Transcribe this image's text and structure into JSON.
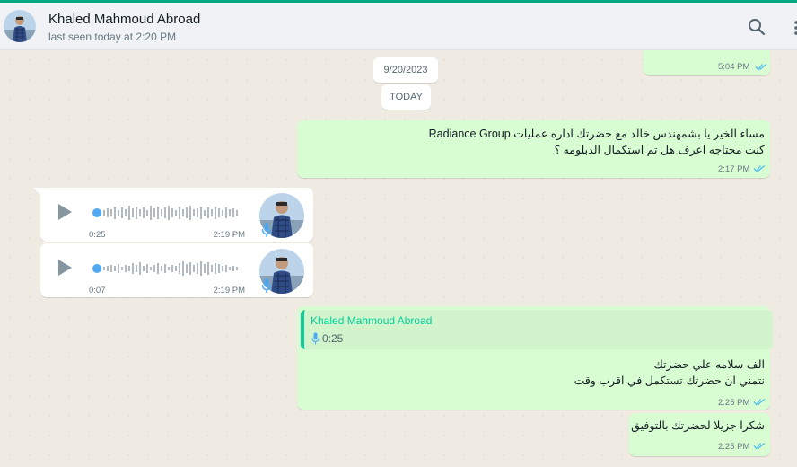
{
  "header": {
    "contact_name": "Khaled Mahmoud Abroad",
    "status": "last seen today at 2:20 PM"
  },
  "chat": {
    "top_partial_message": {
      "time": "5:04 PM"
    },
    "date_chips": [
      "9/20/2023",
      "TODAY"
    ],
    "message_1": {
      "line1": "مساء الخير يا بشمهندس خالد مع حضرتك اداره عمليات Radiance Group",
      "line2": "كنت محتاجه اعرف هل تم استكمال الدبلومه ؟",
      "time": "2:17 PM"
    },
    "voice_1": {
      "duration": "0:25",
      "time": "2:19 PM"
    },
    "voice_2": {
      "duration": "0:07",
      "time": "2:19 PM"
    },
    "reply_message": {
      "quoted_name": "Khaled Mahmoud Abroad",
      "quoted_duration": "0:25",
      "line1": "الف سلامه علي حضرتك",
      "line2": "نتمني ان حضرتك تستكمل في اقرب وقت",
      "time": "2:25 PM"
    },
    "message_last": {
      "text": "شكرا جزيلا لحضرتك بالتوفيق",
      "time": "2:25 PM"
    }
  },
  "icons": {
    "search": "search-icon",
    "menu": "menu-dots-icon",
    "play": "play-icon",
    "mic": "microphone-icon",
    "ticks": "double-check-icon"
  },
  "colors": {
    "accent": "#00a884",
    "outgoing_bubble": "#d9fdd3",
    "incoming_bubble": "#ffffff",
    "read_ticks": "#53bdeb",
    "voice_dot": "#4fa8f1",
    "quote_name": "#06cf9c"
  }
}
